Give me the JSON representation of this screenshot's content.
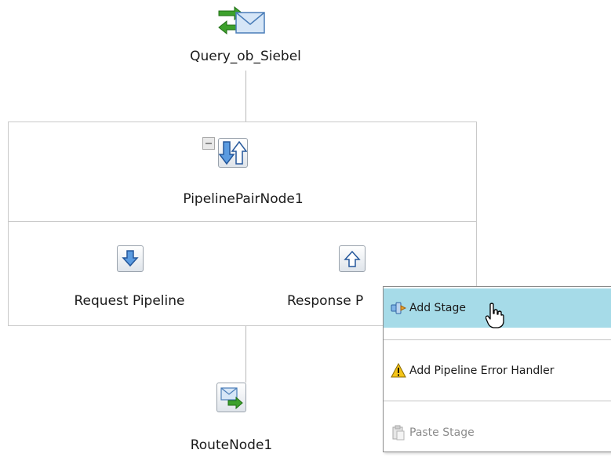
{
  "nodes": {
    "proxy_service": "Query_ob_Siebel",
    "pipeline_pair": "PipelinePairNode1",
    "request_pipeline": "Request Pipeline",
    "response_pipeline": "Response P",
    "route_node": "RouteNode1"
  },
  "context_menu": {
    "items": [
      {
        "label": "Add Stage",
        "icon": "add-stage-icon",
        "state": "highlighted"
      },
      {
        "label": "Add Pipeline Error Handler",
        "icon": "warning-icon",
        "state": "normal"
      },
      {
        "label": "Paste Stage",
        "icon": "paste-icon",
        "state": "disabled"
      }
    ],
    "highlight_color": "#a6dbe8",
    "disabled_color": "#8c8c8c"
  },
  "cursor": {
    "icon": "hand-pointer-icon"
  }
}
